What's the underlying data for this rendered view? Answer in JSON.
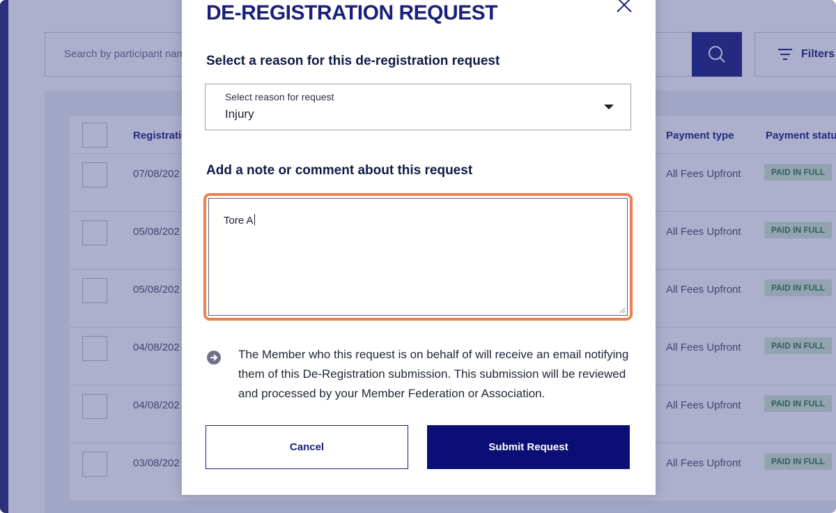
{
  "background": {
    "search": {
      "placeholder": "Search by participant name"
    },
    "filters_label": "Filters",
    "table": {
      "headers": [
        "Registration",
        "Payment type",
        "Payment status"
      ],
      "rows": [
        {
          "date": "07/08/202",
          "payment_type": "All Fees Upfront",
          "payment_status": "PAID IN FULL"
        },
        {
          "date": "05/08/202",
          "payment_type": "All Fees Upfront",
          "payment_status": "PAID IN FULL"
        },
        {
          "date": "05/08/202",
          "payment_type": "All Fees Upfront",
          "payment_status": "PAID IN FULL"
        },
        {
          "date": "04/08/202",
          "payment_type": "All Fees Upfront",
          "payment_status": "PAID IN FULL"
        },
        {
          "date": "04/08/202",
          "payment_type": "All Fees Upfront",
          "payment_status": "PAID IN FULL"
        },
        {
          "date": "03/08/202",
          "payment_type": "All Fees Upfront",
          "payment_status": "PAID IN FULL"
        }
      ]
    }
  },
  "modal": {
    "title": "DE-REGISTRATION REQUEST",
    "reason_heading": "Select a reason for this de-registration request",
    "reason_select": {
      "label": "Select reason for request",
      "value": "Injury"
    },
    "note_heading": "Add a note or comment about this request",
    "note_value": "Tore A",
    "info_text": "The Member who this request is on behalf of will receive an email notifying them of this De-Registration submission. This submission will be reviewed and processed by your Member Federation or Association.",
    "cancel_label": "Cancel",
    "submit_label": "Submit Request"
  },
  "colors": {
    "brand_navy": "#1a1f7a",
    "submit_bg": "#0b0f75",
    "highlight_orange": "#f07f4f",
    "overlay": "rgba(49,58,128,0.40)",
    "paid_badge_bg": "#d6ead4",
    "paid_badge_text": "#2f7a3b"
  },
  "icons": [
    "search-icon",
    "filter-icon",
    "close-icon",
    "chevron-down-icon",
    "arrow-right-circle-icon"
  ]
}
